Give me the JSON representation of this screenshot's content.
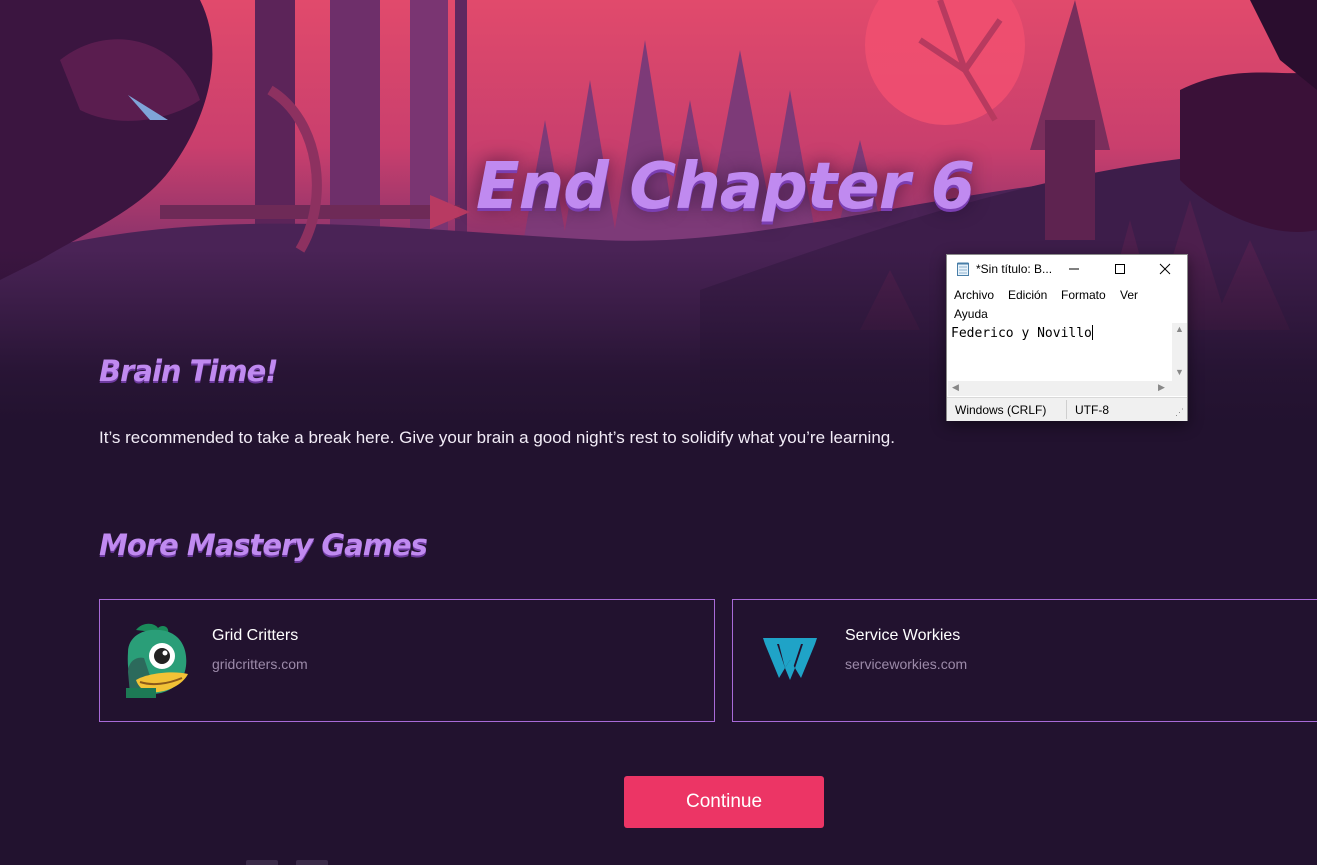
{
  "hero": {
    "title": "End Chapter 6"
  },
  "brain": {
    "heading": "Brain Time!",
    "text": "It’s recommended to take a break here. Give your brain a good night’s rest to solidify what you’re learning."
  },
  "mastery": {
    "heading": "More Mastery Games",
    "games": [
      {
        "name": "Grid Critters",
        "url": "gridcritters.com",
        "icon": "grid-critters-logo"
      },
      {
        "name": "Service Workies",
        "url": "serviceworkies.com",
        "icon": "service-workies-logo"
      }
    ]
  },
  "continue_label": "Continue",
  "notepad": {
    "title": "*Sin título: B...",
    "menu": [
      "Archivo",
      "Edición",
      "Formato",
      "Ver",
      "Ayuda"
    ],
    "content": "Federico y Novillo",
    "status": {
      "line_ending": "Windows (CRLF)",
      "encoding": "UTF-8"
    }
  },
  "colors": {
    "accent": "#c08af0",
    "button": "#ec3565",
    "background": "#22122f",
    "card_border": "#a86ad8"
  }
}
